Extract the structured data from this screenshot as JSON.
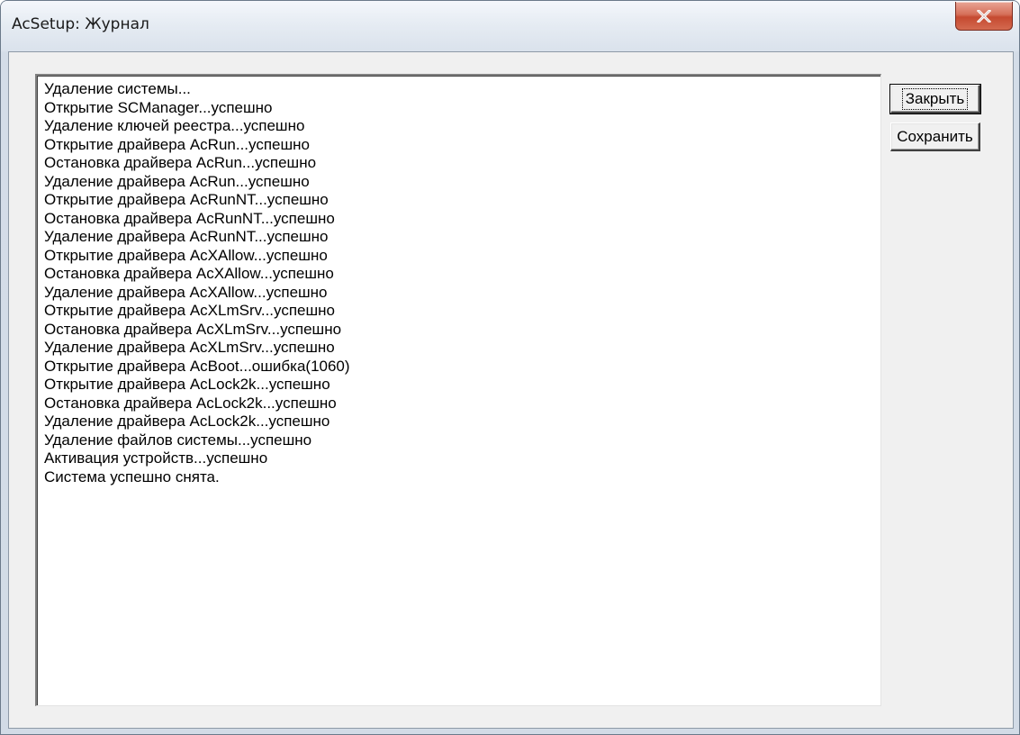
{
  "window": {
    "title": "AcSetup: Журнал",
    "close_icon": "close-x-icon"
  },
  "log": {
    "lines": [
      "Удаление системы...",
      "Открытие SCManager...успешно",
      "Удаление ключей реестра...успешно",
      "Открытие драйвера AcRun...успешно",
      "Остановка драйвера AcRun...успешно",
      "Удаление драйвера AcRun...успешно",
      "Открытие драйвера AcRunNT...успешно",
      "Остановка драйвера AcRunNT...успешно",
      "Удаление драйвера AcRunNT...успешно",
      "Открытие драйвера AcXAllow...успешно",
      "Остановка драйвера AcXAllow...успешно",
      "Удаление драйвера AcXAllow...успешно",
      "Открытие драйвера AcXLmSrv...успешно",
      "Остановка драйвера AcXLmSrv...успешно",
      "Удаление драйвера AcXLmSrv...успешно",
      "Открытие драйвера AcBoot...ошибка(1060)",
      "Открытие драйвера AcLock2k...успешно",
      "Остановка драйвера AcLock2k...успешно",
      "Удаление драйвера AcLock2k...успешно",
      "Удаление файлов системы...успешно",
      "Активация устройств...успешно",
      "Система успешно снята."
    ]
  },
  "buttons": {
    "close_label": "Закрыть",
    "save_label": "Сохранить"
  }
}
